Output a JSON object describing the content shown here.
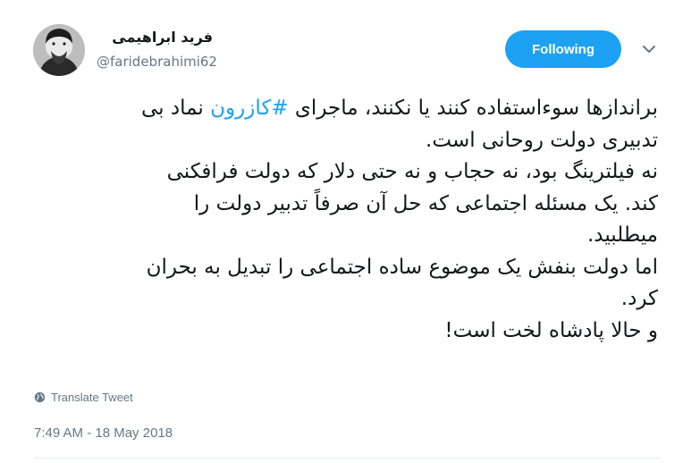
{
  "author": {
    "name": "فرید ابراهیمی",
    "handle": "@faridebrahimi62"
  },
  "follow_button": {
    "label": "Following"
  },
  "tweet": {
    "line1_before": "براندازها سوءاستفاده کنند یا نکنند، ماجرای ",
    "hashtag": "#کازرون",
    "line1_after": " نماد بی",
    "line2": "تدبیری دولت روحانی است.",
    "line3": "نه فیلترینگ بود، نه حجاب و نه حتی دلار که دولت فرافکنی",
    "line4": "کند. یک مسئله اجتماعی که حل آن صرفاً تدبیر دولت را",
    "line5": "میطلبید.",
    "line6": "اما دولت بنفش یک موضوع ساده اجتماعی را تبدیل به بحران",
    "line7": "کرد.",
    "line8": "و حالا پادشاه لخت است!"
  },
  "translate": {
    "label": "Translate Tweet"
  },
  "timestamp": "7:49 AM - 18 May 2018",
  "colors": {
    "accent": "#1da1f2",
    "muted": "#657786",
    "text": "#14171a"
  },
  "icons": {
    "avatar": "profile-photo",
    "caret": "chevron-down-icon",
    "translate": "globe-icon"
  }
}
